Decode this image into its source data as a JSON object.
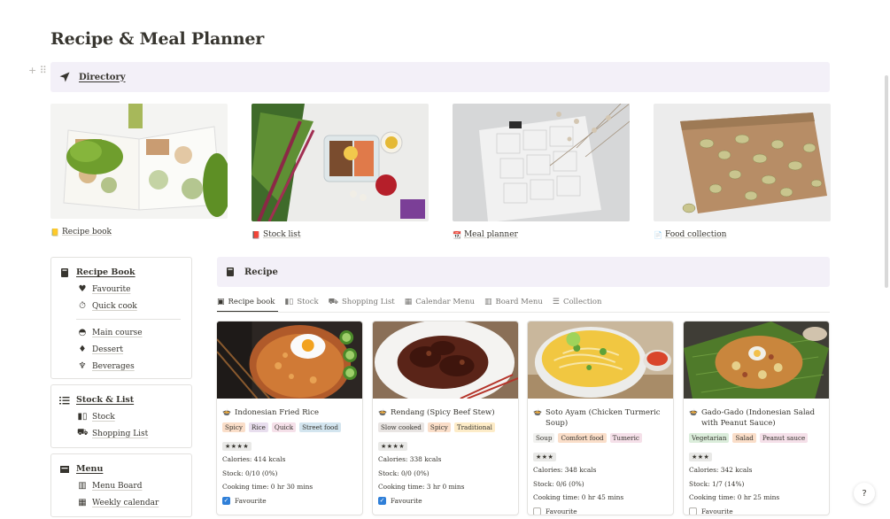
{
  "page": {
    "title": "Recipe & Meal Planner"
  },
  "directory": {
    "label": "Directory",
    "icon": "arrow-icon"
  },
  "gallery": [
    {
      "label": "Recipe book",
      "icon": "notebook-icon"
    },
    {
      "label": "Stock list",
      "icon": "book-icon"
    },
    {
      "label": "Meal planner",
      "icon": "calendar-icon"
    },
    {
      "label": "Food collection",
      "icon": "page-icon"
    }
  ],
  "sidebar": {
    "recipe_book": {
      "title": "Recipe Book",
      "items": [
        {
          "label": "Favourite",
          "icon": "heart-icon"
        },
        {
          "label": "Quick cook",
          "icon": "stopwatch-icon"
        },
        {
          "label": "Main course",
          "icon": "bowl-icon"
        },
        {
          "label": "Dessert",
          "icon": "cake-icon"
        },
        {
          "label": "Beverages",
          "icon": "cup-icon"
        }
      ]
    },
    "stock": {
      "title": "Stock & List",
      "items": [
        {
          "label": "Stock",
          "icon": "bottles-icon"
        },
        {
          "label": "Shopping List",
          "icon": "cart-icon"
        }
      ]
    },
    "menu": {
      "title": "Menu",
      "items": [
        {
          "label": "Menu Board",
          "icon": "columns-icon"
        },
        {
          "label": "Weekly calendar",
          "icon": "calendar-icon"
        }
      ]
    }
  },
  "recipe": {
    "title": "Recipe",
    "tabs": [
      "Recipe book",
      "Stock",
      "Shopping List",
      "Calendar Menu",
      "Board Menu",
      "Collection"
    ],
    "cards": [
      {
        "title": "Indonesian Fried Rice",
        "tags": [
          {
            "label": "Spicy",
            "color": "#fadec9"
          },
          {
            "label": "Rice",
            "color": "#e8deee"
          },
          {
            "label": "Quick",
            "color": "#f5e0e9"
          },
          {
            "label": "Street food",
            "color": "#d3e5ef"
          }
        ],
        "rating": "★★★★",
        "calories": "Calories: 414 kcals",
        "stock": "Stock: 0/10 (0%)",
        "cooking_time": "Cooking time: 0 hr 30 mins",
        "favourite_label": "Favourite",
        "favourite": true
      },
      {
        "title": "Rendang (Spicy Beef Stew)",
        "tags": [
          {
            "label": "Slow cooked",
            "color": "#e9e5e3"
          },
          {
            "label": "Spicy",
            "color": "#fadec9"
          },
          {
            "label": "Traditional",
            "color": "#fdecc8"
          }
        ],
        "rating": "★★★★",
        "calories": "Calories: 338 kcals",
        "stock": "Stock: 0/0 (0%)",
        "cooking_time": "Cooking time: 3 hr 0 mins",
        "favourite_label": "Favourite",
        "favourite": true
      },
      {
        "title": "Soto Ayam (Chicken Turmeric Soup)",
        "tags": [
          {
            "label": "Soup",
            "color": "#f1f1ef"
          },
          {
            "label": "Comfort food",
            "color": "#fadec9"
          },
          {
            "label": "Tumeric",
            "color": "#f5e0e9"
          }
        ],
        "rating": "★★★",
        "calories": "Calories: 348 kcals",
        "stock": "Stock: 0/6 (0%)",
        "cooking_time": "Cooking time: 0 hr 45 mins",
        "favourite_label": "Favourite",
        "favourite": false
      },
      {
        "title": "Gado-Gado (Indonesian Salad with Peanut Sauce)",
        "tags": [
          {
            "label": "Vegetarian",
            "color": "#dbeddb"
          },
          {
            "label": "Salad",
            "color": "#fadec9"
          },
          {
            "label": "Peanut sauce",
            "color": "#f5e0e9"
          }
        ],
        "rating": "★★★",
        "calories": "Calories: 342 kcals",
        "stock": "Stock: 1/7 (14%)",
        "cooking_time": "Cooking time: 0 hr 25 mins",
        "favourite_label": "Favourite",
        "favourite": false
      }
    ]
  },
  "help": {
    "label": "?"
  }
}
